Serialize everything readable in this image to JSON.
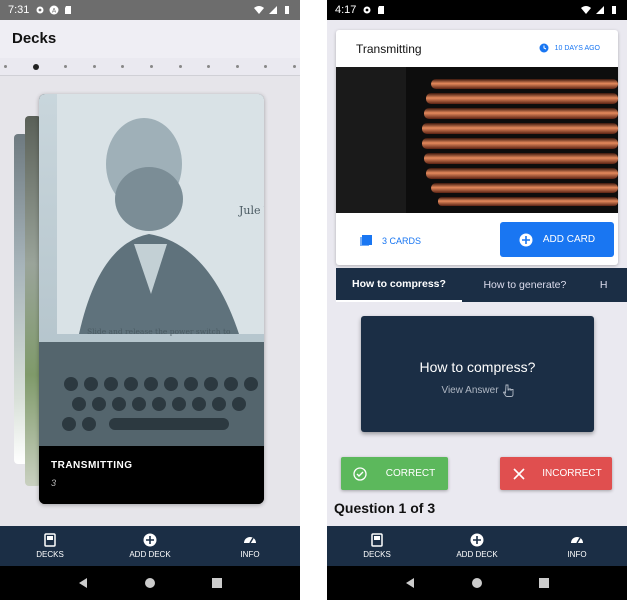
{
  "left_screen": {
    "status": {
      "time": "7:31"
    },
    "header": {
      "title": "Decks"
    },
    "carousel": {
      "dot_count": 11,
      "active_dot": 1,
      "card": {
        "title": "TRANSMITTING",
        "count": "3",
        "art_caption": "Slide and release the power switch to",
        "art_name": "Jule Ve"
      }
    },
    "bottom_nav": [
      {
        "label": "DECKS",
        "icon": "cards-icon"
      },
      {
        "label": "ADD DECK",
        "icon": "plus-circle-icon"
      },
      {
        "label": "INFO",
        "icon": "gauge-icon"
      }
    ]
  },
  "right_screen": {
    "status": {
      "time": "4:17"
    },
    "deck_card": {
      "title": "Transmitting",
      "timestamp": "10 DAYS AGO",
      "card_count": "3 CARDS",
      "add_button": "ADD CARD"
    },
    "tabs": [
      "How to compress?",
      "How to generate?",
      "H"
    ],
    "active_tab": 0,
    "question_card": {
      "question": "How to compress?",
      "view_answer": "View Answer"
    },
    "actions": {
      "correct": "CORRECT",
      "incorrect": "INCORRECT"
    },
    "progress_text": "Question 1 of 3",
    "bottom_nav": [
      {
        "label": "DECKS",
        "icon": "cards-icon"
      },
      {
        "label": "ADD DECK",
        "icon": "plus-circle-icon"
      },
      {
        "label": "INFO",
        "icon": "gauge-icon"
      }
    ]
  },
  "colors": {
    "navy": "#1b2e45",
    "accent_blue": "#1976f2",
    "correct_green": "#5cb85c",
    "incorrect_red": "#e04f4f"
  }
}
